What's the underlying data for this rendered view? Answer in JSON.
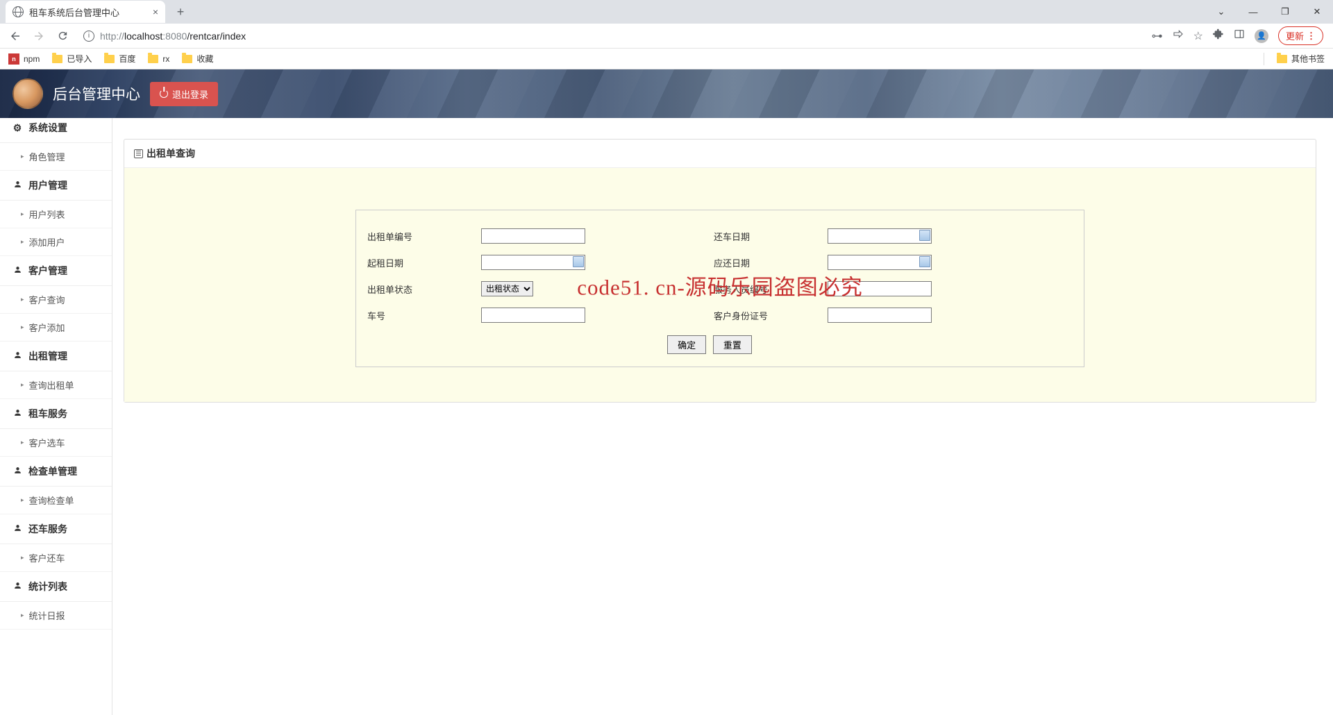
{
  "browser": {
    "tab_title": "租车系统后台管理中心",
    "url_proto": "http://",
    "url_host": "localhost",
    "url_port": ":8080",
    "url_path": "/rentcar/index",
    "update_label": "更新"
  },
  "bookmarks": {
    "items": [
      "npm",
      "已导入",
      "百度",
      "rx",
      "收藏"
    ],
    "other": "其他书签"
  },
  "header": {
    "title": "后台管理中心",
    "logout": "退出登录"
  },
  "sidebar": {
    "groups": [
      {
        "title": "系统设置",
        "icon": "gear",
        "items": [
          "角色管理"
        ]
      },
      {
        "title": "用户管理",
        "icon": "user",
        "items": [
          "用户列表",
          "添加用户"
        ]
      },
      {
        "title": "客户管理",
        "icon": "user",
        "items": [
          "客户查询",
          "客户添加"
        ]
      },
      {
        "title": "出租管理",
        "icon": "user",
        "items": [
          "查询出租单"
        ]
      },
      {
        "title": "租车服务",
        "icon": "user",
        "items": [
          "客户选车"
        ]
      },
      {
        "title": "检查单管理",
        "icon": "user",
        "items": [
          "查询检查单"
        ]
      },
      {
        "title": "还车服务",
        "icon": "user",
        "items": [
          "客户还车"
        ]
      },
      {
        "title": "统计列表",
        "icon": "user",
        "items": [
          "统计日报"
        ]
      }
    ]
  },
  "panel": {
    "title": "出租单查询",
    "form": {
      "rental_no": "出租单编号",
      "return_date": "还车日期",
      "start_date": "起租日期",
      "due_date": "应还日期",
      "status": "出租单状态",
      "status_option": "出租状态",
      "staff_no": "服务人员编号",
      "car_no": "车号",
      "customer_id": "客户身份证号",
      "submit": "确定",
      "reset": "重置"
    }
  },
  "watermark": "code51. cn-源码乐园盗图必究"
}
